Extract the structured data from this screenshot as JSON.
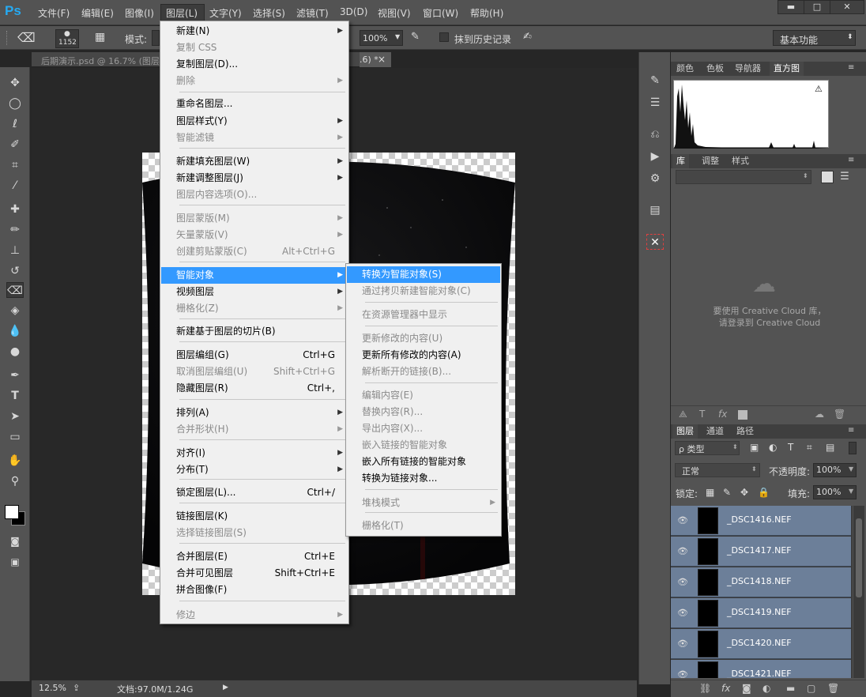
{
  "app": {
    "logo": "Ps",
    "accent": "#26aaf2"
  },
  "menubar": {
    "items": [
      "文件(F)",
      "编辑(E)",
      "图像(I)",
      "图层(L)",
      "文字(Y)",
      "选择(S)",
      "滤镜(T)",
      "3D(D)",
      "视图(V)",
      "窗口(W)",
      "帮助(H)"
    ],
    "active": "图层(L)"
  },
  "window_controls": [
    "▬",
    "□",
    "✕"
  ],
  "options_bar": {
    "brush_size": "1152",
    "mode_label": "模式:",
    "flow_value": "100%",
    "history_label": "抹到历史记录",
    "workspace": "基本功能"
  },
  "document": {
    "tab_title": "后期演示.psd @ 16.7% (图层",
    "tab_suffix": ".6) *",
    "tab_close": "×"
  },
  "status": {
    "zoom": "12.5%",
    "doc_size": "文档:97.0M/1.24G"
  },
  "layer_menu": {
    "items": [
      {
        "label": "新建(N)",
        "shortcut": "",
        "submenu": true,
        "disabled": false
      },
      {
        "label": "复制 CSS",
        "shortcut": "",
        "submenu": false,
        "disabled": true
      },
      {
        "label": "复制图层(D)...",
        "shortcut": "",
        "submenu": false,
        "disabled": false
      },
      {
        "label": "删除",
        "shortcut": "",
        "submenu": true,
        "disabled": true
      },
      {
        "label": "重命名图层...",
        "shortcut": "",
        "submenu": false,
        "disabled": false
      },
      {
        "label": "图层样式(Y)",
        "shortcut": "",
        "submenu": true,
        "disabled": false
      },
      {
        "label": "智能滤镜",
        "shortcut": "",
        "submenu": true,
        "disabled": true
      },
      {
        "label": "新建填充图层(W)",
        "shortcut": "",
        "submenu": true,
        "disabled": false
      },
      {
        "label": "新建调整图层(J)",
        "shortcut": "",
        "submenu": true,
        "disabled": false
      },
      {
        "label": "图层内容选项(O)...",
        "shortcut": "",
        "submenu": false,
        "disabled": true
      },
      {
        "label": "图层蒙版(M)",
        "shortcut": "",
        "submenu": true,
        "disabled": true
      },
      {
        "label": "矢量蒙版(V)",
        "shortcut": "",
        "submenu": true,
        "disabled": true
      },
      {
        "label": "创建剪贴蒙版(C)",
        "shortcut": "Alt+Ctrl+G",
        "submenu": false,
        "disabled": true
      },
      {
        "label": "智能对象",
        "shortcut": "",
        "submenu": true,
        "disabled": false,
        "highlighted": true
      },
      {
        "label": "视频图层",
        "shortcut": "",
        "submenu": true,
        "disabled": false
      },
      {
        "label": "栅格化(Z)",
        "shortcut": "",
        "submenu": true,
        "disabled": true
      },
      {
        "label": "新建基于图层的切片(B)",
        "shortcut": "",
        "submenu": false,
        "disabled": false
      },
      {
        "label": "图层编组(G)",
        "shortcut": "Ctrl+G",
        "submenu": false,
        "disabled": false
      },
      {
        "label": "取消图层编组(U)",
        "shortcut": "Shift+Ctrl+G",
        "submenu": false,
        "disabled": true
      },
      {
        "label": "隐藏图层(R)",
        "shortcut": "Ctrl+,",
        "submenu": false,
        "disabled": false
      },
      {
        "label": "排列(A)",
        "shortcut": "",
        "submenu": true,
        "disabled": false
      },
      {
        "label": "合并形状(H)",
        "shortcut": "",
        "submenu": true,
        "disabled": true
      },
      {
        "label": "对齐(I)",
        "shortcut": "",
        "submenu": true,
        "disabled": false
      },
      {
        "label": "分布(T)",
        "shortcut": "",
        "submenu": true,
        "disabled": false
      },
      {
        "label": "锁定图层(L)...",
        "shortcut": "Ctrl+/",
        "submenu": false,
        "disabled": false
      },
      {
        "label": "链接图层(K)",
        "shortcut": "",
        "submenu": false,
        "disabled": false
      },
      {
        "label": "选择链接图层(S)",
        "shortcut": "",
        "submenu": false,
        "disabled": true
      },
      {
        "label": "合并图层(E)",
        "shortcut": "Ctrl+E",
        "submenu": false,
        "disabled": false
      },
      {
        "label": "合并可见图层",
        "shortcut": "Shift+Ctrl+E",
        "submenu": false,
        "disabled": false
      },
      {
        "label": "拼合图像(F)",
        "shortcut": "",
        "submenu": false,
        "disabled": false
      },
      {
        "label": "修边",
        "shortcut": "",
        "submenu": true,
        "disabled": true
      }
    ]
  },
  "smart_object_menu": {
    "items": [
      {
        "label": "转换为智能对象(S)",
        "disabled": false,
        "highlighted": true
      },
      {
        "label": "通过拷贝新建智能对象(C)",
        "disabled": true
      },
      {
        "label": "在资源管理器中显示",
        "disabled": true
      },
      {
        "label": "更新修改的内容(U)",
        "disabled": true
      },
      {
        "label": "更新所有修改的内容(A)",
        "disabled": false
      },
      {
        "label": "解析断开的链接(B)...",
        "disabled": true
      },
      {
        "label": "编辑内容(E)",
        "disabled": true
      },
      {
        "label": "替换内容(R)...",
        "disabled": true
      },
      {
        "label": "导出内容(X)...",
        "disabled": true
      },
      {
        "label": "嵌入链接的智能对象",
        "disabled": true
      },
      {
        "label": "嵌入所有链接的智能对象",
        "disabled": false
      },
      {
        "label": "转换为链接对象...",
        "disabled": false
      },
      {
        "label": "堆栈模式",
        "disabled": true,
        "submenu": true
      },
      {
        "label": "栅格化(T)",
        "disabled": true
      }
    ]
  },
  "panels": {
    "top_tabs": [
      "颜色",
      "色板",
      "导航器",
      "直方图"
    ],
    "lib_tabs": [
      "库",
      "调整",
      "样式"
    ],
    "cc_message": "要使用 Creative Cloud 库，\n请登录到 Creative Cloud",
    "layers_tabs": [
      "图层",
      "通道",
      "路径"
    ],
    "filter_kind": "ρ 类型",
    "blend_mode": "正常",
    "opacity_label": "不透明度:",
    "opacity_value": "100%",
    "lock_label": "锁定:",
    "fill_label": "填充:",
    "fill_value": "100%",
    "layers": [
      "_DSC1416.NEF",
      "_DSC1417.NEF",
      "_DSC1418.NEF",
      "_DSC1419.NEF",
      "_DSC1420.NEF",
      "_DSC1421.NEF"
    ]
  }
}
